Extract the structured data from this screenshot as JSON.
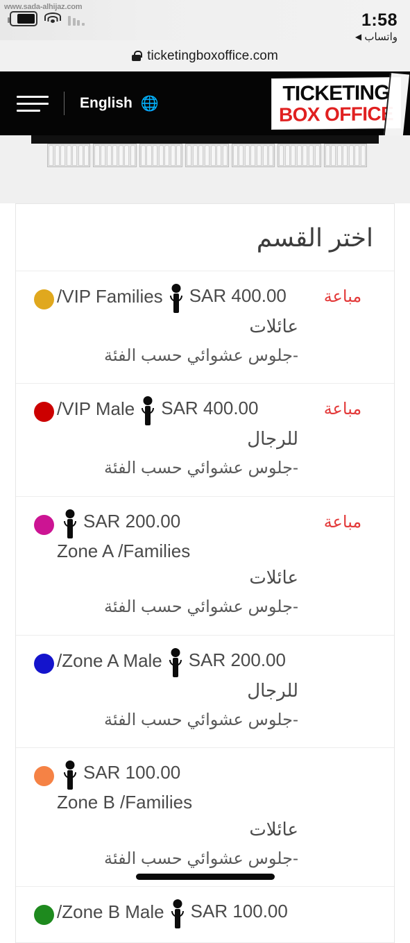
{
  "status_bar": {
    "watermark": "www.sada-alhijaz.com",
    "time": "1:58",
    "notification": "واتساب",
    "notification_arrow": "◀",
    "battery_icon": "battery-icon",
    "wifi_icon": "wifi-icon",
    "signal_icon": "signal-bars-icon"
  },
  "browser": {
    "url": "ticketingboxoffice.com",
    "lock_icon": "lock-icon"
  },
  "navbar": {
    "menu_icon": "hamburger-menu-icon",
    "language": "English",
    "globe_icon": "🌐",
    "logo_line1": "TICKETING",
    "logo_line2": "BOX OFFICE"
  },
  "page": {
    "title": "اختر القسم"
  },
  "zones": [
    {
      "color": "#E0A81E",
      "name_en": "/VIP Families",
      "name_ar": "عائلات",
      "price": "SAR 400.00",
      "status": "مباعة",
      "sold_out": true,
      "note": "-جلوس عشوائي حسب الفئة"
    },
    {
      "color": "#CC0000",
      "name_en": "/VIP Male",
      "name_ar": "للرجال",
      "price": "SAR 400.00",
      "status": "مباعة",
      "sold_out": true,
      "note": "-جلوس عشوائي حسب الفئة"
    },
    {
      "color": "#CC1493",
      "name_en": "Zone A /Families",
      "name_ar": "عائلات",
      "price": "SAR 200.00",
      "status": "مباعة",
      "sold_out": true,
      "note": "-جلوس عشوائي حسب الفئة"
    },
    {
      "color": "#1414CC",
      "name_en": "/Zone A Male",
      "name_ar": "للرجال",
      "price": "SAR 200.00",
      "status": "",
      "sold_out": false,
      "note": "-جلوس عشوائي حسب الفئة"
    },
    {
      "color": "#F58245",
      "name_en": "Zone B /Families",
      "name_ar": "عائلات",
      "price": "SAR 100.00",
      "status": "",
      "sold_out": false,
      "note": "-جلوس عشوائي حسب الفئة"
    },
    {
      "color": "#1E8A1E",
      "name_en": "/Zone B Male",
      "name_ar": "",
      "price": "SAR 100.00",
      "status": "",
      "sold_out": false,
      "note": ""
    }
  ]
}
